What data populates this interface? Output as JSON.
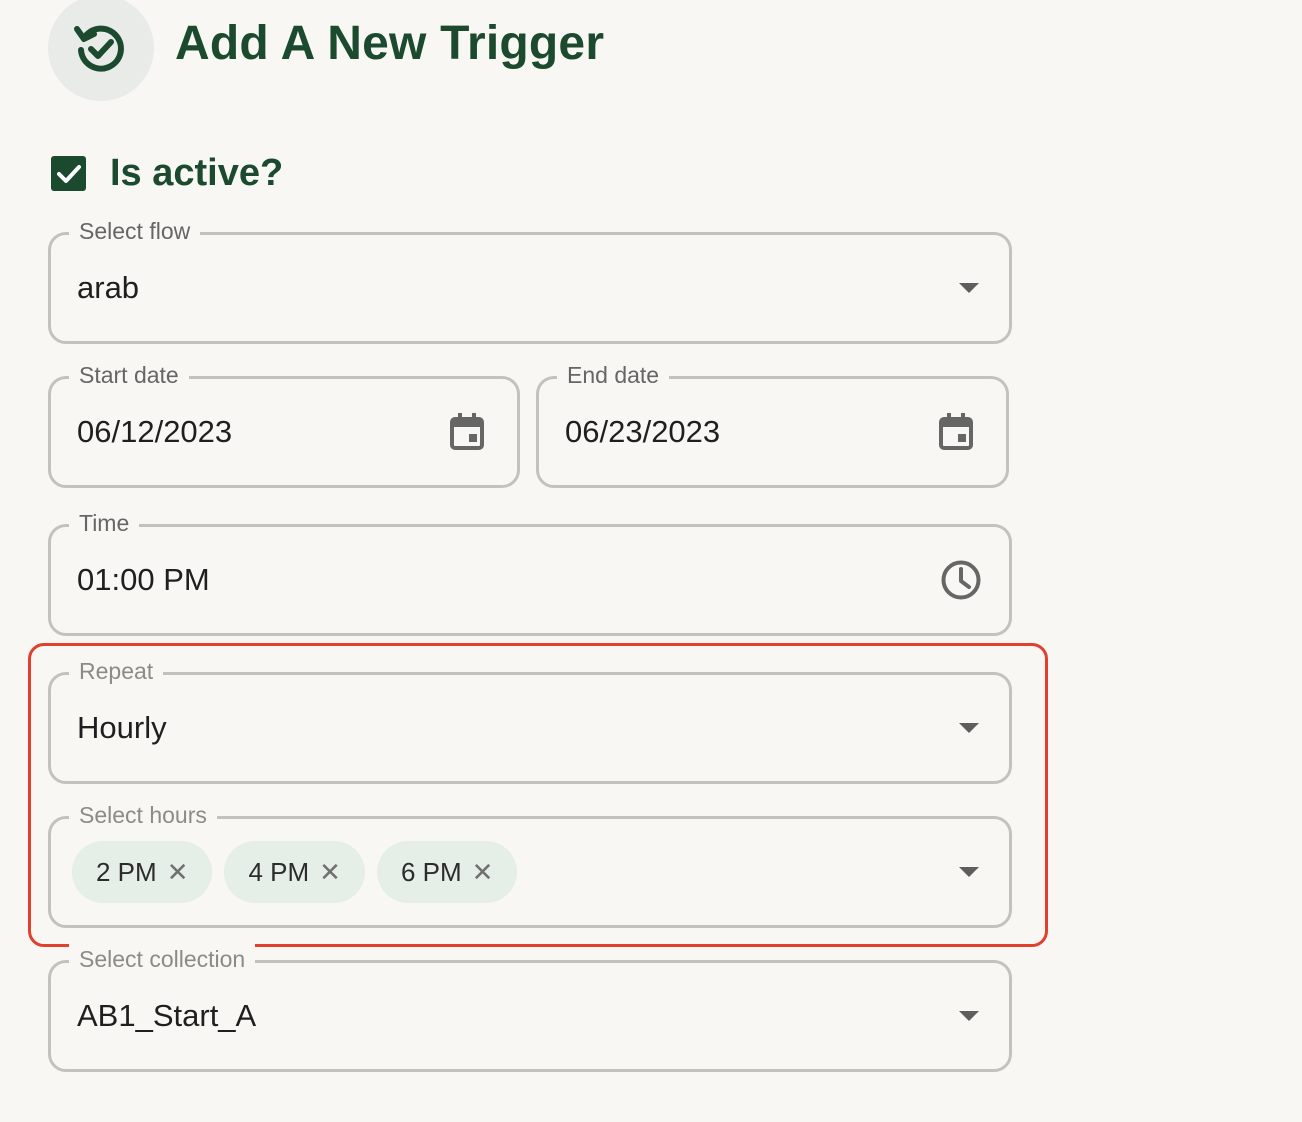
{
  "header": {
    "title": "Add A New Trigger",
    "icon": "schedule-check-icon"
  },
  "is_active": {
    "label": "Is active?",
    "checked": true
  },
  "fields": {
    "flow": {
      "label": "Select flow",
      "value": "arab"
    },
    "start_date": {
      "label": "Start date",
      "value": "06/12/2023",
      "icon": "calendar-icon"
    },
    "end_date": {
      "label": "End date",
      "value": "06/23/2023",
      "icon": "calendar-icon"
    },
    "time": {
      "label": "Time",
      "value": "01:00 PM",
      "icon": "clock-icon"
    },
    "repeat": {
      "label": "Repeat",
      "value": "Hourly"
    },
    "hours": {
      "label": "Select hours",
      "chips": [
        {
          "label": "2 PM",
          "remove": "✕"
        },
        {
          "label": "4 PM",
          "remove": "✕"
        },
        {
          "label": "6 PM",
          "remove": "✕"
        }
      ]
    },
    "collection": {
      "label": "Select collection",
      "value": "AB1_Start_A"
    }
  },
  "colors": {
    "brand": "#1b4a2f",
    "highlight": "#e0402d",
    "chip_bg": "#e6eee8",
    "background": "#f8f7f3"
  }
}
